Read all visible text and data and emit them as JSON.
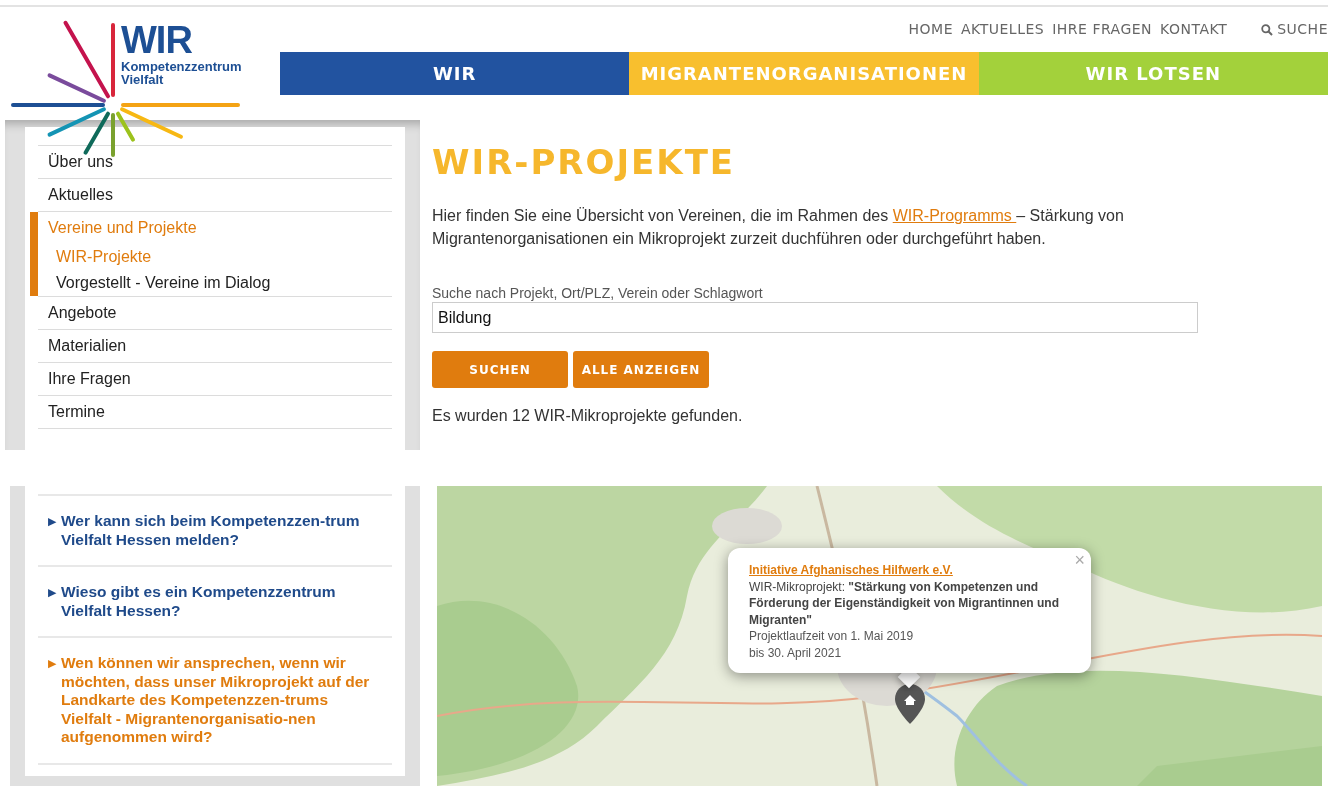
{
  "logo": {
    "title": "WIR",
    "subtitle_lines": [
      "Kompetenzzentrum",
      "Vielfalt"
    ]
  },
  "top_links": [
    {
      "label": "HOME"
    },
    {
      "label": "AKTUELLES"
    },
    {
      "label": "IHRE FRAGEN"
    },
    {
      "label": "KONTAKT"
    }
  ],
  "search_link": {
    "label": "SUCHE"
  },
  "main_nav": [
    {
      "label": "WIR",
      "color": "#2253a0"
    },
    {
      "label": "MIGRANTENORGANISATIONEN",
      "color": "#f8bf2e"
    },
    {
      "label": "WIR LOTSEN",
      "color": "#a3d13b"
    }
  ],
  "sidebar": {
    "items": [
      {
        "label": "Über uns",
        "selected": false
      },
      {
        "label": "Aktuelles",
        "selected": false
      },
      {
        "label": "Vereine und Projekte",
        "selected": true,
        "children": [
          {
            "label": "WIR-Projekte",
            "selected": true
          },
          {
            "label": "Vorgestellt - Vereine im Dialog",
            "selected": false
          }
        ]
      },
      {
        "label": "Angebote",
        "selected": false
      },
      {
        "label": "Materialien",
        "selected": false
      },
      {
        "label": "Ihre Fragen",
        "selected": false
      },
      {
        "label": "Termine",
        "selected": false
      }
    ]
  },
  "heading": "WIR-PROJEKTE",
  "intro": {
    "before": "Hier finden Sie eine Übersicht von Vereinen, die im Rahmen des ",
    "link": "WIR-Programms ",
    "after": "– Stärkung von Migrantenorganisationen ein Mikroprojekt zurzeit duchführen oder durchgeführt haben."
  },
  "search": {
    "label": "Suche nach Projekt, Ort/PLZ, Verein oder Schlagwort",
    "value": "Bildung"
  },
  "buttons": [
    "SUCHEN",
    "ALLE ANZEIGEN"
  ],
  "result_text": "Es wurden 12 WIR-Mikroprojekte gefunden.",
  "faq": [
    {
      "icon": "▶",
      "text": "Wer kann sich beim Kompetenzzen-trum Vielfalt Hessen melden?",
      "selected": false
    },
    {
      "icon": "▶",
      "text": "Wieso gibt es ein Kompetenzzentrum Vielfalt Hessen?",
      "selected": false
    },
    {
      "icon": "▶",
      "text": "Wen können wir ansprechen, wenn wir möchten, dass unser Mikroprojekt auf der Landkarte des Kompetenzzen-trums Vielfalt - Migrantenorganisatio-nen aufgenommen wird?",
      "selected": true
    }
  ],
  "map": {
    "kind": "picture",
    "popup": {
      "close": "×",
      "title": "Initiative Afghanisches Hilfwerk e.V.",
      "description": "WIR-Mikroprojekt: **\"Stärkung von Kompetenzen und Förderung der Eigenständigkeit von Migrantinnen und Migranten\"**",
      "runtime_lines": [
        "Projektlaufzeit von 1. Mai 2019",
        "bis 30. April 2021"
      ]
    }
  }
}
